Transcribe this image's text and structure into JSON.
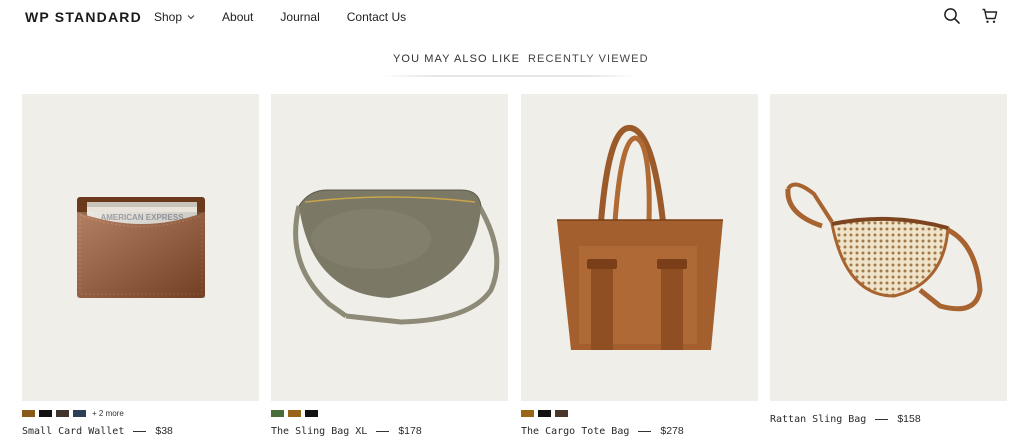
{
  "header": {
    "logo": "WP STANDARD",
    "nav": [
      "Shop",
      "About",
      "Journal",
      "Contact Us"
    ],
    "icons": [
      "search-icon",
      "cart-icon"
    ]
  },
  "tabs": [
    {
      "label": "YOU MAY ALSO LIKE",
      "active": true
    },
    {
      "label": "RECENTLY VIEWED",
      "active": false
    }
  ],
  "products": [
    {
      "name": "Small Card Wallet",
      "price": "$38",
      "swatches": [
        "#8a5a1a",
        "#111111",
        "#3f352c",
        "#2d3e57"
      ],
      "more": "+ 2 more",
      "image_text": "AMERICAN EXPRESS"
    },
    {
      "name": "The Sling Bag XL",
      "price": "$178",
      "swatches": [
        "#4a6b3a",
        "#9a6418",
        "#111111"
      ]
    },
    {
      "name": "The Cargo Tote Bag",
      "price": "$278",
      "swatches": [
        "#9a6418",
        "#111111",
        "#4a3729"
      ]
    },
    {
      "name": "Rattan Sling Bag",
      "price": "$158",
      "swatches": []
    }
  ]
}
